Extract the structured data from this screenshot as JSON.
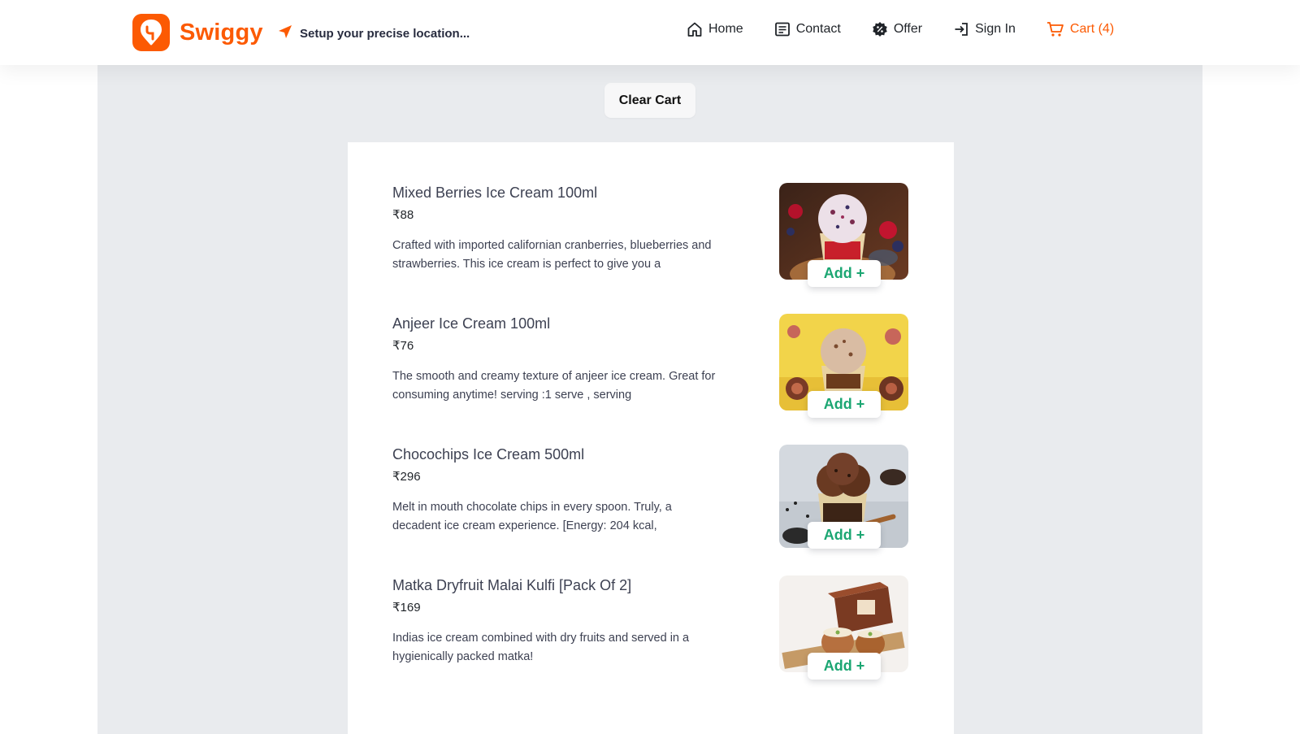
{
  "header": {
    "brand": "Swiggy",
    "location_prompt": "Setup your precise location...",
    "nav": [
      {
        "label": "Home",
        "icon": "home-icon"
      },
      {
        "label": "Contact",
        "icon": "contact-icon"
      },
      {
        "label": "Offer",
        "icon": "offer-icon"
      },
      {
        "label": "Sign In",
        "icon": "sign-in-icon"
      },
      {
        "label": "Cart (4)",
        "icon": "cart-icon"
      }
    ]
  },
  "actions": {
    "clear_cart": "Clear Cart"
  },
  "cart": {
    "items": [
      {
        "name": "Mixed Berries Ice Cream 100ml",
        "price": "₹88",
        "description": "Crafted with imported californian cranberries, blueberries and strawberries. This ice cream is perfect to give you a",
        "add_label": "Add +"
      },
      {
        "name": "Anjeer Ice Cream 100ml",
        "price": "₹76",
        "description": "The smooth and creamy texture of anjeer ice cream. Great for consuming anytime! serving :1 serve , serving",
        "add_label": "Add +"
      },
      {
        "name": "Chocochips Ice Cream 500ml",
        "price": "₹296",
        "description": "Melt in mouth chocolate chips in every spoon. Truly, a decadent ice cream experience. [Energy: 204 kcal,",
        "add_label": "Add +"
      },
      {
        "name": "Matka Dryfruit Malai Kulfi [Pack Of 2]",
        "price": "₹169",
        "description": "Indias ice cream combined with dry fruits and served in a hygienically packed matka!",
        "add_label": "Add +"
      }
    ]
  },
  "colors": {
    "brand": "#fc5a03",
    "add_text": "#1ba672",
    "page_bg": "#e9ebee"
  }
}
